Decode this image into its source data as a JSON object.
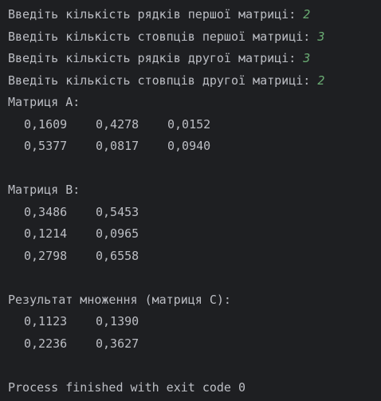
{
  "prompts": [
    {
      "text": "Введіть кількість рядків першої матриці: ",
      "value": "2"
    },
    {
      "text": "Введіть кількість стовпців першої матриці: ",
      "value": "3"
    },
    {
      "text": "Введіть кількість рядків другої матриці: ",
      "value": "3"
    },
    {
      "text": "Введіть кількість стовпців другої матриці: ",
      "value": "2"
    }
  ],
  "matrix_a": {
    "title": "Матриця А:",
    "rows": [
      [
        "0,1609",
        "0,4278",
        "0,0152"
      ],
      [
        "0,5377",
        "0,0817",
        "0,0940"
      ]
    ]
  },
  "matrix_b": {
    "title": "Матриця B:",
    "rows": [
      [
        "0,3486",
        "0,5453"
      ],
      [
        "0,1214",
        "0,0965"
      ],
      [
        "0,2798",
        "0,6558"
      ]
    ]
  },
  "matrix_c": {
    "title": "Результат множення (матриця C):",
    "rows": [
      [
        "0,1123",
        "0,1390"
      ],
      [
        "0,2236",
        "0,3627"
      ]
    ]
  },
  "exit_message": "Process finished with exit code 0",
  "colors": {
    "background": "#1e1f22",
    "text": "#bcbec4",
    "input": "#6aab73"
  }
}
